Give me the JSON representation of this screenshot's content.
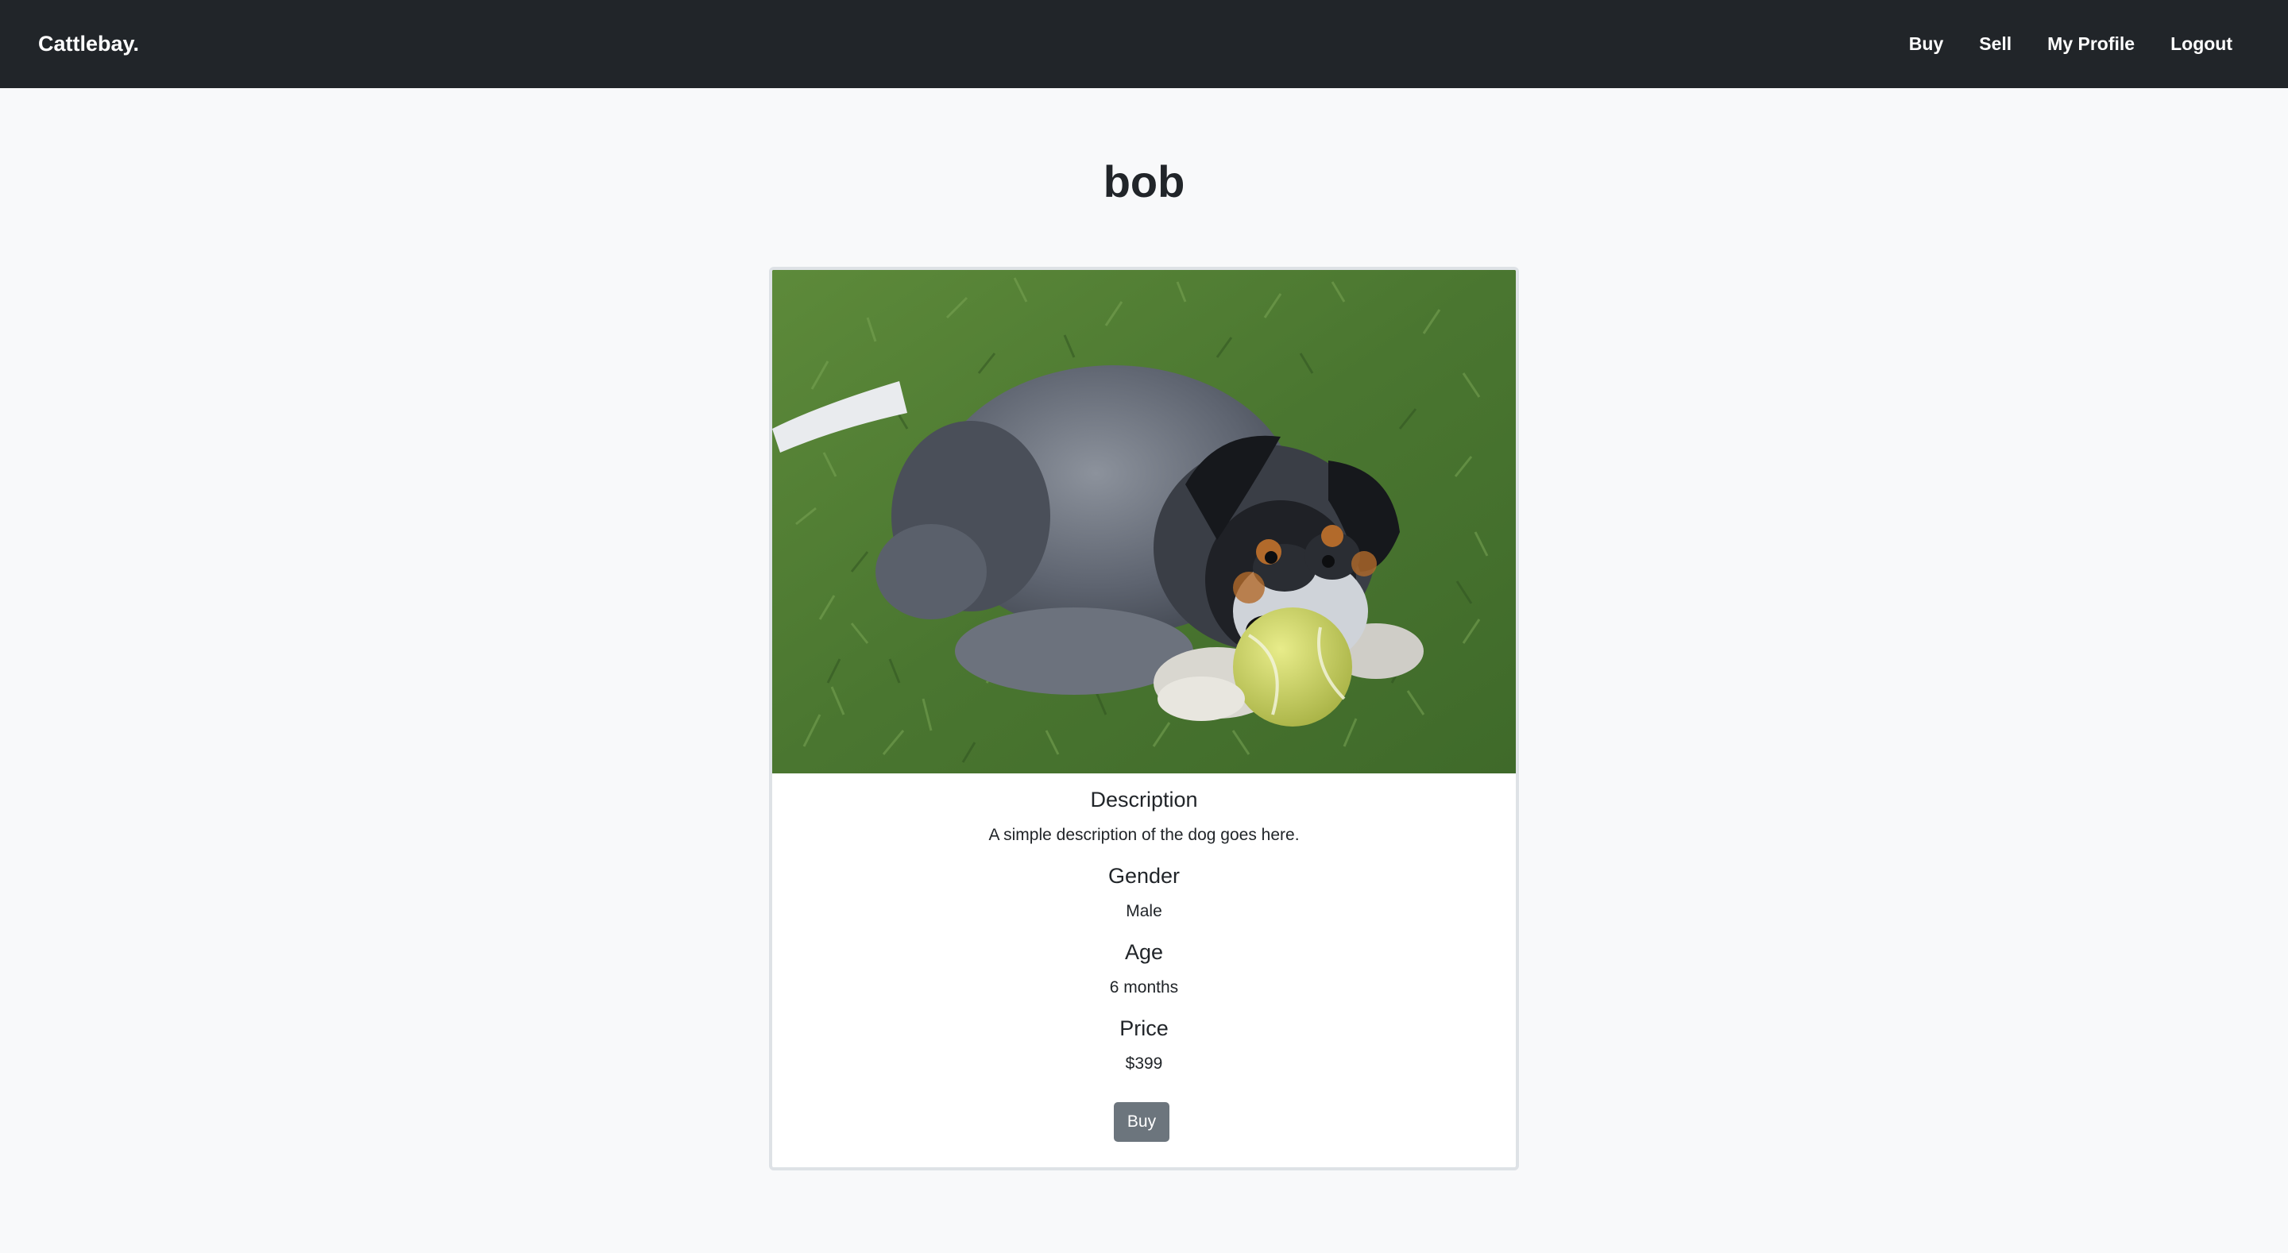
{
  "navbar": {
    "brand": "Cattlebay.",
    "links": [
      "Buy",
      "Sell",
      "My Profile",
      "Logout"
    ]
  },
  "page": {
    "title": "bob"
  },
  "listing": {
    "image_alt": "puppy with tennis ball",
    "fields": [
      {
        "label": "Description",
        "value": "A simple description of the dog goes here."
      },
      {
        "label": "Gender",
        "value": "Male"
      },
      {
        "label": "Age",
        "value": "6 months"
      },
      {
        "label": "Price",
        "value": "$399"
      }
    ],
    "buy_label": "Buy"
  },
  "colors": {
    "navbar_bg": "#212529",
    "page_bg": "#f8f9fa",
    "button_bg": "#6c757d"
  }
}
